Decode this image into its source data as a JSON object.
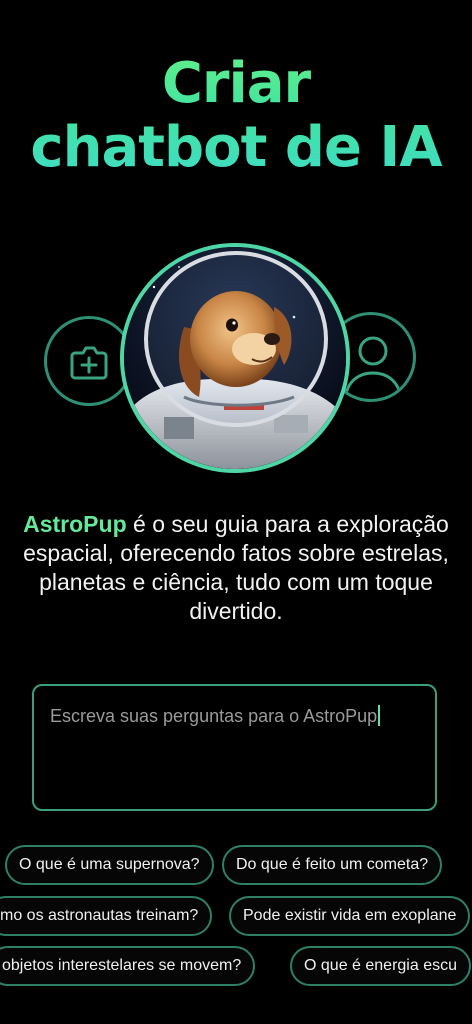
{
  "header": {
    "title_line1": "Criar",
    "title_line2": "chatbot de IA"
  },
  "icons": {
    "left": "add-photo-icon",
    "right": "user-icon",
    "avatar": "astronaut-dog-avatar"
  },
  "description": {
    "bot_name": "AstroPup",
    "text": " é o seu guia para a exploração espacial, oferecendo fatos sobre estrelas, planetas e ciência, tudo com um toque divertido."
  },
  "prompt": {
    "placeholder": "Escreva suas perguntas para o AstroPup"
  },
  "suggestions": {
    "row1": [
      "O que é uma supernova?",
      "Do que é feito um cometa?"
    ],
    "row2": [
      "mo os astronautas treinam?",
      "Pode existir vida em exoplane"
    ],
    "row3": [
      "objetos interestelares se movem?",
      "O que é energia escu"
    ]
  },
  "colors": {
    "background": "#000000",
    "accent_green": "#4ed6a6",
    "title_gradient_start": "#5ff08a",
    "title_gradient_end": "#3fdcc4",
    "border": "#2f8f74"
  }
}
